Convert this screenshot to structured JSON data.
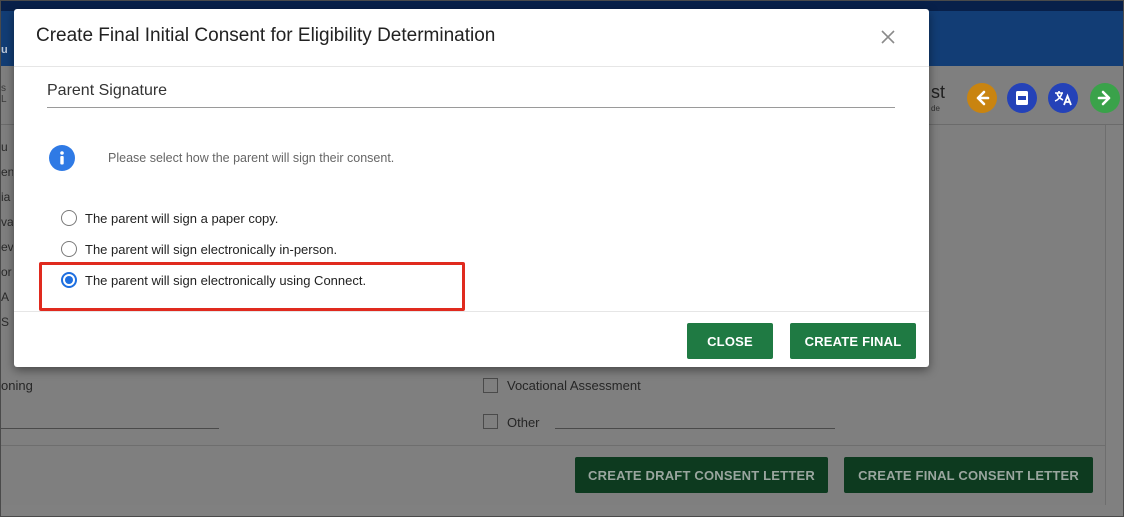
{
  "background": {
    "header_crumb": "u",
    "sub_left_text": [
      "s",
      "L"
    ],
    "sub_right_title": "st",
    "sub_right_sub": "de",
    "side_letters": [
      "u",
      "en",
      "ia",
      "va",
      "ev",
      "or",
      "A",
      "S"
    ],
    "left_label": "oning",
    "checkbox_labels": {
      "vocational": "Vocational Assessment",
      "other": "Other"
    },
    "buttons": {
      "draft": "CREATE DRAFT CONSENT LETTER",
      "final": "CREATE FINAL CONSENT LETTER"
    },
    "icons": [
      "arrow-left-icon",
      "pdf-icon",
      "translate-icon",
      "arrow-right-icon"
    ],
    "icon_colors": {
      "back": "#c98410",
      "pdf": "#2442b8",
      "lang": "#2442b8",
      "next": "#3aa24a"
    }
  },
  "modal": {
    "title": "Create Final Initial Consent for Eligibility Determination",
    "close_icon": "close-icon",
    "section_heading": "Parent Signature",
    "info_icon": "info-icon",
    "info_text": "Please select how the parent will sign their consent.",
    "options": [
      {
        "label": "The parent will sign a paper copy.",
        "checked": false
      },
      {
        "label": "The parent will sign electronically in-person.",
        "checked": false
      },
      {
        "label": "The parent will sign electronically using Connect.",
        "checked": true
      }
    ],
    "buttons": {
      "close": "CLOSE",
      "create_final": "CREATE FINAL"
    },
    "colors": {
      "primary_button": "#1f7a43",
      "radio_selected": "#1e6fe0",
      "info": "#2f7ae5",
      "highlight": "#e02a1e"
    }
  }
}
